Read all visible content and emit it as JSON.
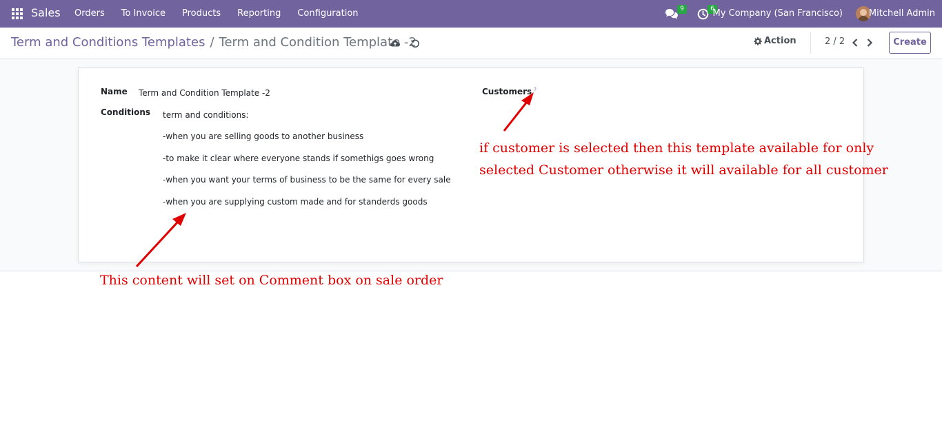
{
  "navbar": {
    "brand": "Sales",
    "menu": [
      "Orders",
      "To Invoice",
      "Products",
      "Reporting",
      "Configuration"
    ],
    "messages_badge": "9",
    "activities_badge": "6",
    "company": "My Company (San Francisco)",
    "user": "Mitchell Admin"
  },
  "control": {
    "breadcrumb_parent": "Term and Conditions Templates",
    "breadcrumb_separator": "/",
    "breadcrumb_current": "Term and Condition Template -2",
    "action_label": "Action",
    "pager": "2 / 2",
    "create_label": "Create"
  },
  "form": {
    "name_label": "Name",
    "name_value": "Term and Condition Template -2",
    "conditions_label": "Conditions",
    "conditions": [
      "term and conditions:",
      "-when you are selling goods to another business",
      "-to make it clear  where everyone stands if  somethigs goes wrong",
      "-when you want your terms of business to be  the same for every sale",
      "-when you are supplying custom made  and  for standerds goods"
    ],
    "customers_label": "Customers",
    "customers_help": "?"
  },
  "annotations": {
    "customer_note_line1": "if customer is selected then this  template available  for only",
    "customer_note_line2": "selected Customer otherwise it will  available for all customer",
    "content_note": "This  content will set on  Comment box on sale order"
  },
  "colors": {
    "navbar": "#71639e",
    "annotation": "#e00000",
    "badge": "#28a745"
  }
}
